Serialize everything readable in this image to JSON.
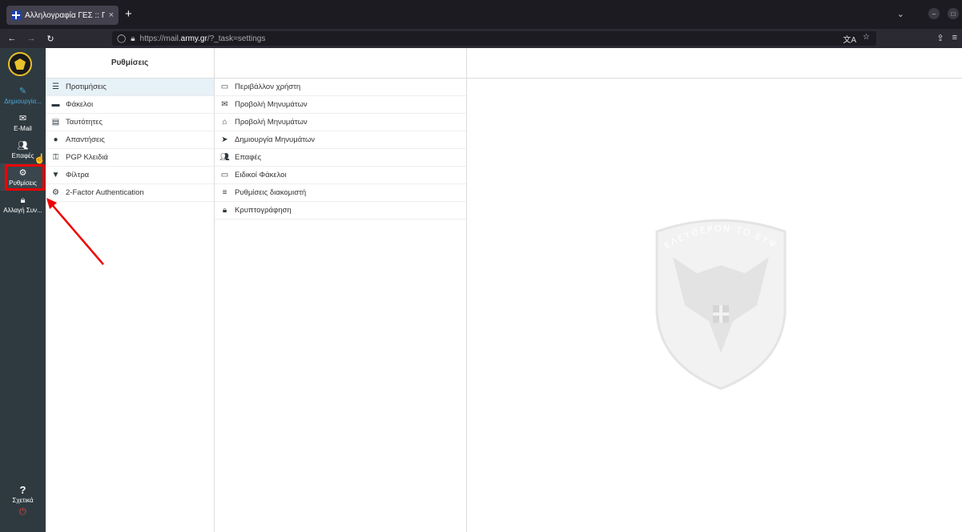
{
  "browser": {
    "tab_title": "Αλληλογραφία ΓΕΣ :: Προ",
    "tab_close": "×",
    "new_tab": "+",
    "url_prefix": "https://mail.",
    "url_domain": "army.gr",
    "url_suffix": "/?_task=settings",
    "status_url": "https://mail.army.gr/?_task=settings"
  },
  "leftnav": {
    "compose": "Δημιουργία...",
    "mail": "E-Mail",
    "contacts": "Επαφές",
    "settings": "Ρυθμίσεις",
    "password": "Αλλαγή Συν...",
    "about": "Σχετικά"
  },
  "settings": {
    "header": "Ρυθμίσεις",
    "sections": [
      {
        "label": "Προτιμήσεις",
        "icon": "sliders-icon"
      },
      {
        "label": "Φάκελοι",
        "icon": "folder-icon"
      },
      {
        "label": "Ταυτότητες",
        "icon": "id-card-icon"
      },
      {
        "label": "Απαντήσεις",
        "icon": "comment-icon"
      },
      {
        "label": "PGP Κλειδιά",
        "icon": "key-icon"
      },
      {
        "label": "Φίλτρα",
        "icon": "filter-icon"
      },
      {
        "label": "2-Factor Authentication",
        "icon": "gear-icon"
      }
    ]
  },
  "preferences": {
    "sections": [
      {
        "label": "Περιβάλλον χρήστη",
        "icon": "monitor-icon"
      },
      {
        "label": "Προβολή Μηνυμάτων",
        "icon": "envelope-icon"
      },
      {
        "label": "Προβολή Μηνυμάτων",
        "icon": "inbox-icon"
      },
      {
        "label": "Δημιουργία Μηνυμάτων",
        "icon": "paper-plane-icon"
      },
      {
        "label": "Επαφές",
        "icon": "users-icon"
      },
      {
        "label": "Ειδικοί Φάκελοι",
        "icon": "folder-outline-icon"
      },
      {
        "label": "Ρυθμίσεις διακομιστή",
        "icon": "server-icon"
      },
      {
        "label": "Κρυπτογράφηση",
        "icon": "lock-icon"
      }
    ]
  },
  "watermark_text": "ΕΛΕΥΘΕΡΟΝ ΤΟ ΕΥΨΥΧΟΝ",
  "colors": {
    "accent": "#e00000",
    "nav_bg": "#2f3a40",
    "selected_row": "#e6f1f8"
  }
}
